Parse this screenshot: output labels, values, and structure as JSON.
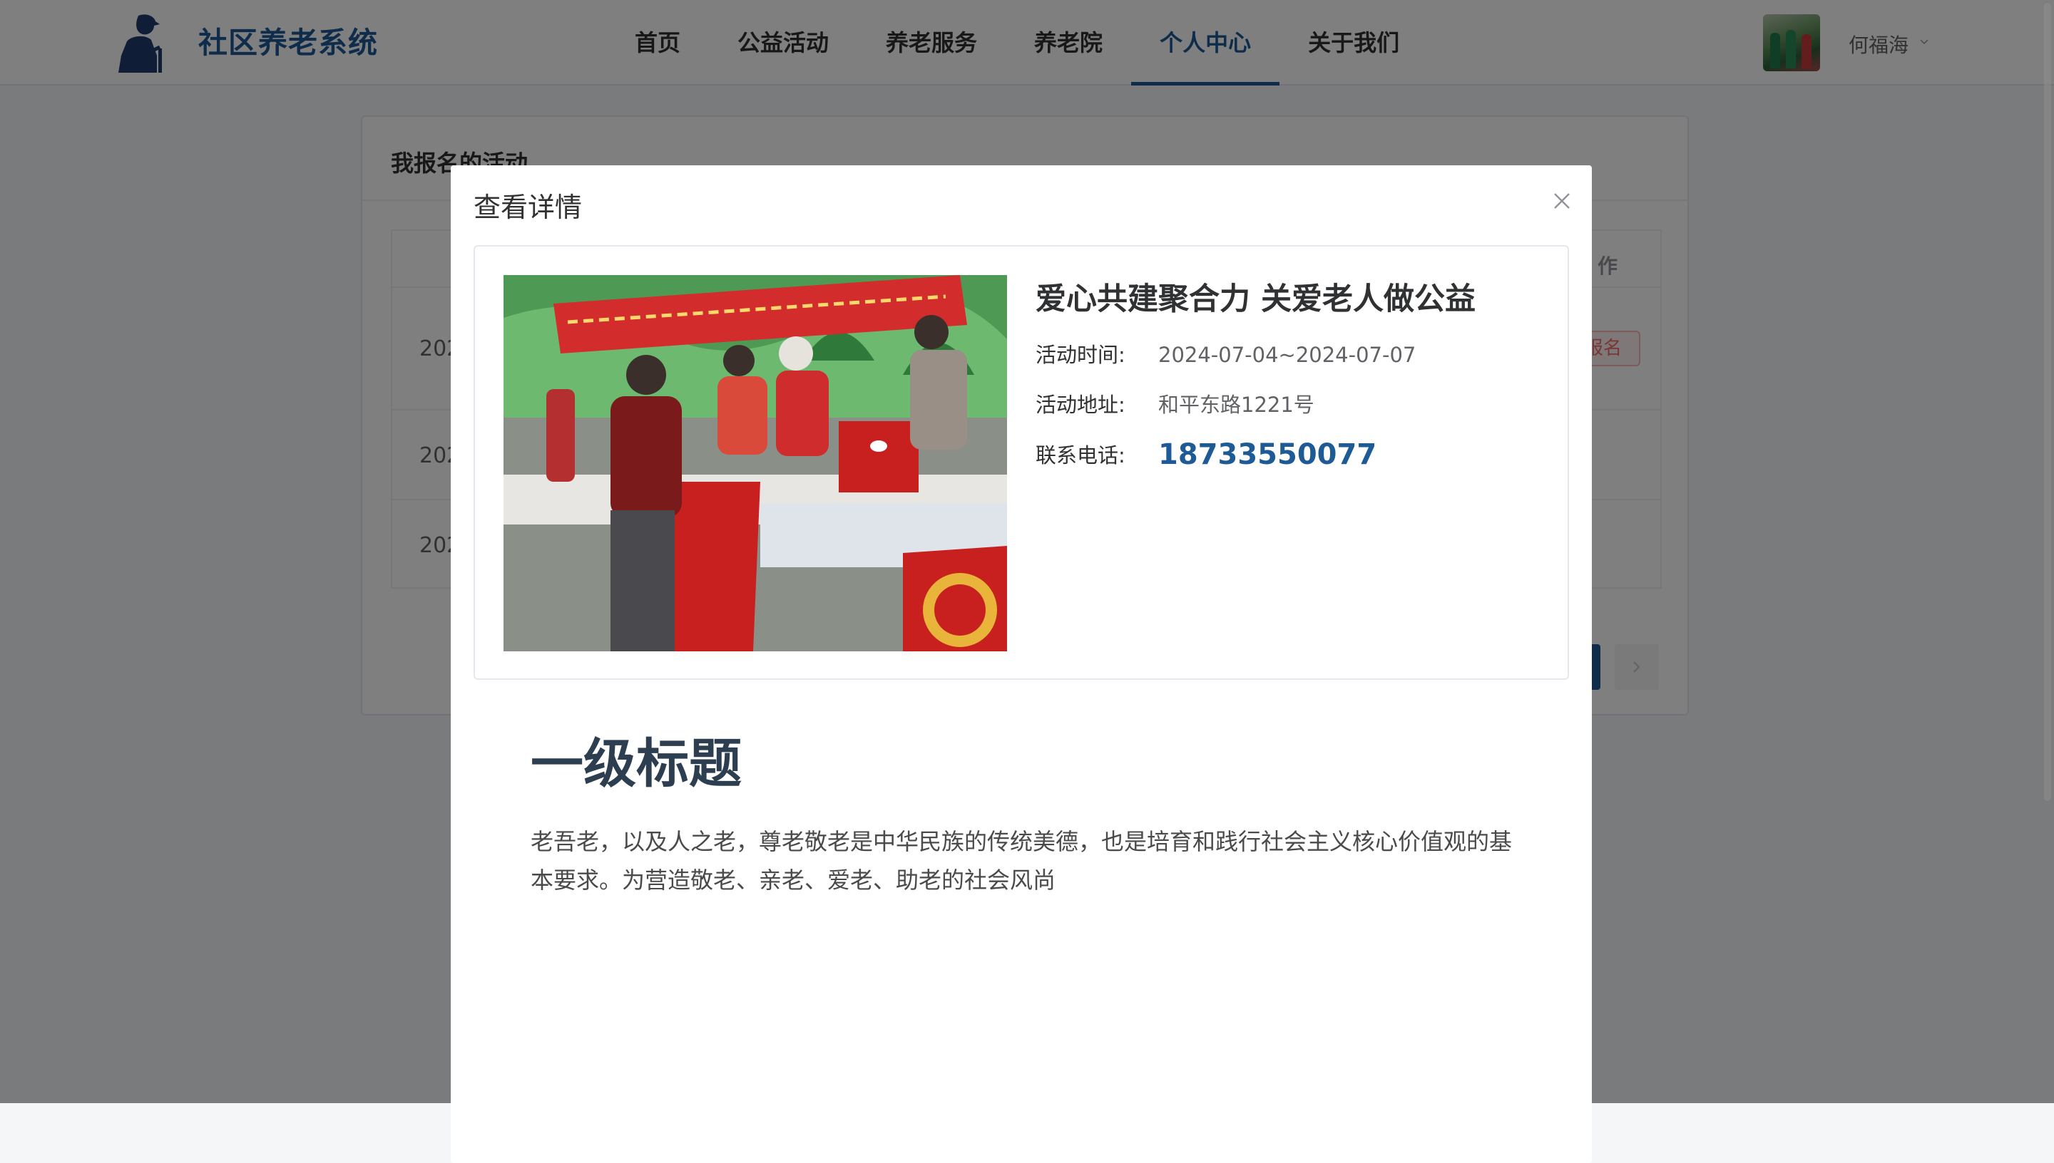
{
  "app": {
    "title": "社区养老系统"
  },
  "nav": {
    "items": [
      {
        "label": "首页"
      },
      {
        "label": "公益活动"
      },
      {
        "label": "养老服务"
      },
      {
        "label": "养老院"
      },
      {
        "label": "个人中心"
      },
      {
        "label": "关于我们"
      }
    ],
    "active_index": 4
  },
  "user": {
    "name": "何福海"
  },
  "background_page": {
    "card_title": "我报名的活动",
    "op_header": "作",
    "rows": [
      {
        "date_prefix": "202",
        "tag": "报名"
      },
      {
        "date_prefix": "202"
      },
      {
        "date_prefix": "202"
      }
    ]
  },
  "dialog": {
    "title": "查看详情",
    "activity": {
      "title": "爱心共建聚合力 关爱老人做公益",
      "time_label": "活动时间:",
      "time_value": "2024-07-04~2024-07-07",
      "address_label": "活动地址:",
      "address_value": "和平东路1221号",
      "phone_label": "联系电话:",
      "phone_value": "18733550077"
    },
    "content": {
      "heading": "一级标题",
      "paragraph": "老吾老，以及人之老，尊老敬老是中华民族的传统美德，也是培育和践行社会主义核心价值观的基本要求。为营造敬老、亲老、爱老、助老的社会风尚"
    }
  },
  "colors": {
    "brand": "#1e5b96",
    "tag_red": "#f56c6c"
  }
}
